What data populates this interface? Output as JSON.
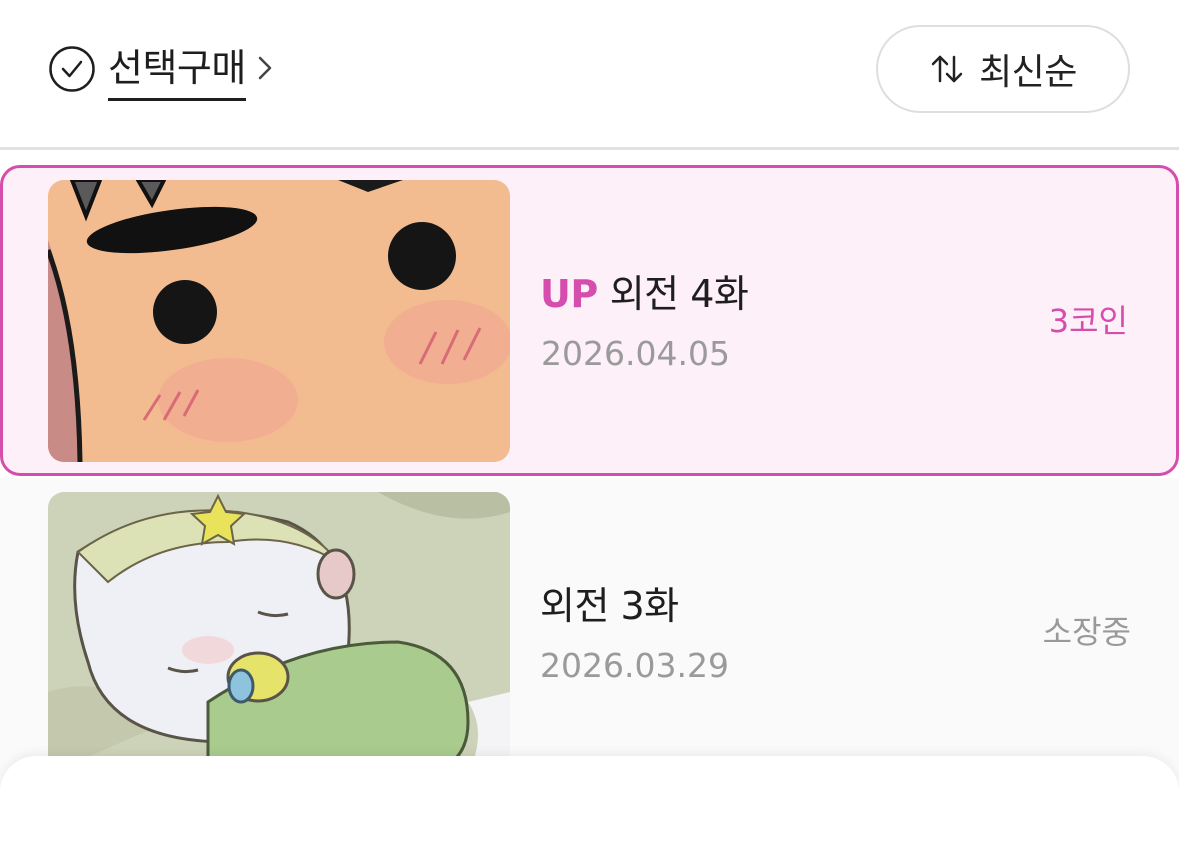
{
  "header": {
    "select_buy_label": "선택구매",
    "sort_label": "최신순"
  },
  "episodes": [
    {
      "badge": "UP",
      "title": "외전 4화",
      "date": "2026.04.05",
      "price": "3코인",
      "highlighted": true
    },
    {
      "title": "외전 3화",
      "date": "2026.03.29",
      "price": "소장중",
      "highlighted": false
    }
  ],
  "icons": {
    "select": "check-circle-icon",
    "chevron": "chevron-right-icon",
    "sort": "sort-arrows-icon"
  },
  "colors": {
    "accent": "#d64ead",
    "highlight_bg": "#fdf0f8",
    "muted_text": "#9a9a9a",
    "divider": "#e2e2e2"
  }
}
